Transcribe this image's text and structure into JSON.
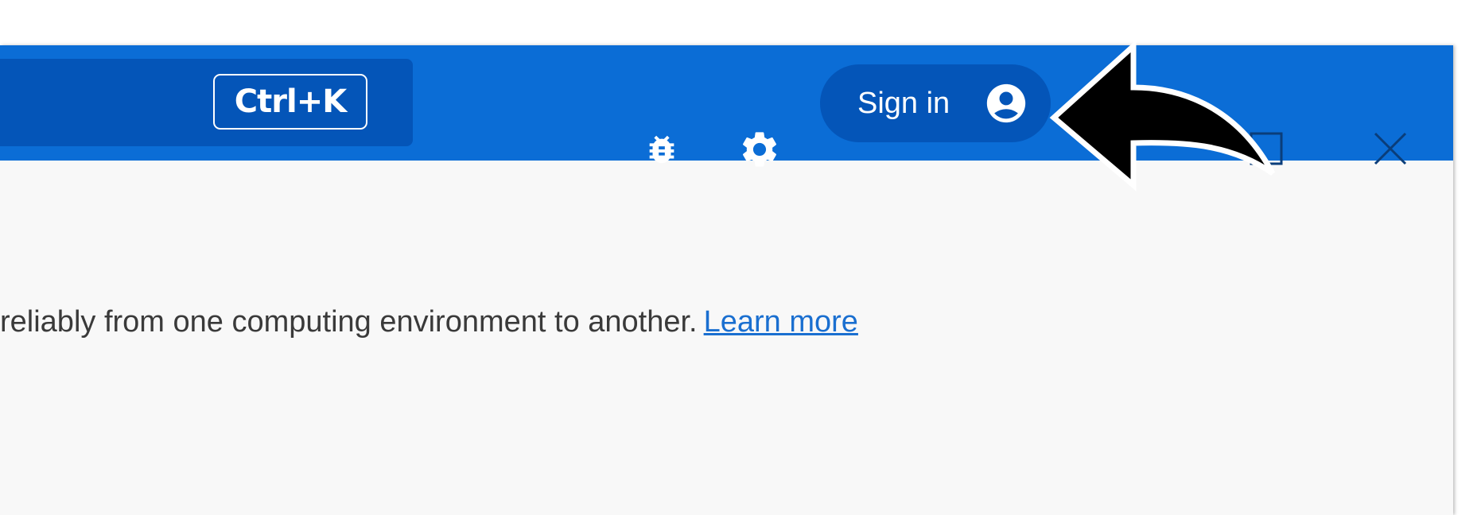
{
  "toolbar": {
    "search_shortcut": "Ctrl+K",
    "bug_icon": "bug-icon",
    "settings_icon": "gear-icon",
    "sign_in_label": "Sign in",
    "account_icon": "account-circle-icon"
  },
  "window_controls": {
    "maximize_icon": "maximize-icon",
    "close_icon": "close-icon"
  },
  "main": {
    "description": "reliably from one computing environment to another.",
    "learn_more_label": "Learn more"
  },
  "colors": {
    "titlebar": "#0b6dd6",
    "search_box": "#0455b8",
    "sign_in_button": "#0455b8",
    "content_background": "#f8f8f8",
    "link": "#1a6fd0"
  }
}
